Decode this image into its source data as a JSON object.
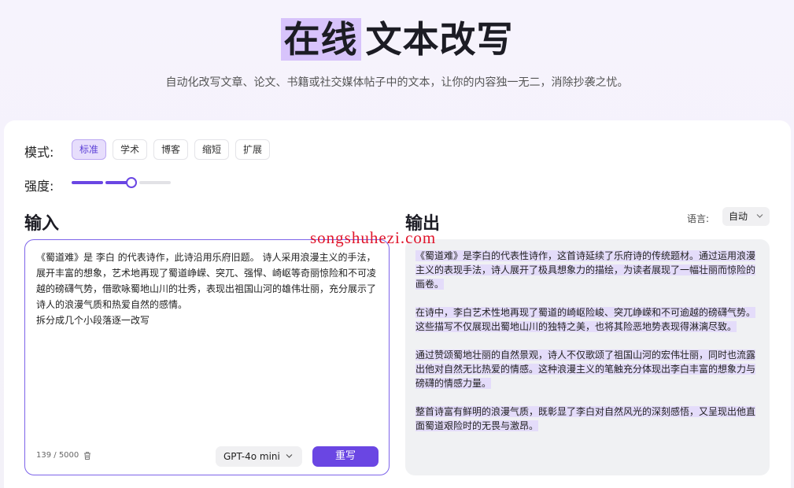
{
  "hero": {
    "title_highlight": "在线",
    "title_rest": "文本改写",
    "subtitle": "自动化改写文章、论文、书籍或社交媒体帖子中的文本，让你的内容独一无二，消除抄袭之忧。"
  },
  "controls": {
    "mode_label": "模式:",
    "modes": [
      "标准",
      "学术",
      "博客",
      "缩短",
      "扩展"
    ],
    "active_mode": "标准",
    "strength_label": "强度:",
    "strength_level": 2,
    "strength_max": 3
  },
  "input": {
    "title": "输入",
    "text": "《蜀道难》是 李白 的代表诗作，此诗沿用乐府旧题。 诗人采用浪漫主义的手法，展开丰富的想象，艺术地再现了蜀道峥嵘、突兀、强悍、崎岖等奇丽惊险和不可凌越的磅礴气势，借歌咏蜀地山川的壮秀，表现出祖国山河的雄伟壮丽，充分展示了诗人的浪漫气质和热爱自然的感情。\n拆分成几个小段落逐一改写",
    "counter": "139 / 5000",
    "model": "GPT-4o mini",
    "rewrite_label": "重写"
  },
  "output": {
    "title": "输出",
    "language_label": "语言:",
    "language_value": "自动",
    "paragraphs": [
      "《蜀道难》是李白的代表性诗作，这首诗延续了乐府诗的传统题材。通过运用浪漫主义的表现手法，诗人展开了极具想象力的描绘，为读者展现了一幅壮丽而惊险的画卷。",
      "在诗中，李白艺术性地再现了蜀道的崎岖险峻、突兀峥嵘和不可逾越的磅礴气势。这些描写不仅展现出蜀地山川的独特之美，也将其险恶地势表现得淋漓尽致。",
      "通过赞颂蜀地壮丽的自然景观，诗人不仅歌颂了祖国山河的宏伟壮丽，同时也流露出他对自然无比热爱的情感。这种浪漫主义的笔触充分体现出李白丰富的想象力与磅礴的情感力量。",
      "整首诗富有鲜明的浪漫气质，既彰显了李白对自然风光的深刻感悟，又呈现出他直面蜀道艰险时的无畏与激昂。"
    ]
  },
  "watermark": "songshuhezi.com",
  "colors": {
    "accent": "#6a46e3",
    "highlight": "#d7c3fb",
    "output_bg": "#f0f1f3"
  }
}
